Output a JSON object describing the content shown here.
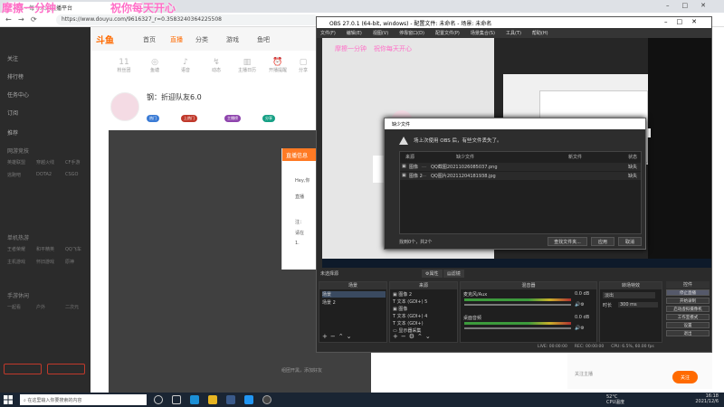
{
  "overlay": {
    "left": "摩擦一分钟",
    "right": "祝你每天开心"
  },
  "browser": {
    "tab_title": "斗鱼 - 每个人的直播平台",
    "url": "https://www.douyu.com/9616327_r=0.3583240364225508",
    "nav_items": [
      "首页",
      "直播",
      "分类",
      "游戏",
      "鱼吧"
    ],
    "logo": "斗鱼",
    "icon_row": [
      {
        "glyph": "11",
        "label": "粉丝团"
      },
      {
        "glyph": "◎",
        "label": "鱼塘"
      },
      {
        "glyph": "♪",
        "label": "语音"
      },
      {
        "glyph": "↯",
        "label": "动态"
      },
      {
        "glyph": "▥",
        "label": "主播日历"
      },
      {
        "glyph": "⏰",
        "label": "开播提醒"
      },
      {
        "glyph": "▢",
        "label": "分享"
      }
    ],
    "streamer_name": "钢：折迎队友6.0",
    "badges": [
      "热门",
      "上热门",
      "主播榜",
      "分享"
    ],
    "sidebar_items": [
      "关注",
      "排行榜",
      "任务中心",
      "订阅",
      "推荐"
    ],
    "sidebar_heads": [
      "网游竞技",
      "单机热游",
      "手游休闲"
    ],
    "sidebar_grid": [
      [
        "英雄联盟",
        "穿越火线",
        "CF手游"
      ],
      [
        "逃跑吧",
        "DOTA2",
        "CSGO"
      ],
      [
        "王者荣耀",
        "和平精英",
        "QQ飞车"
      ],
      [
        "主机游戏",
        "怀旧游戏",
        "原神"
      ],
      [
        "一起看",
        "户外",
        "二次元"
      ]
    ],
    "dialog_title": "直播信息",
    "dialog_lines": [
      "Hey,你",
      "直播",
      "注：",
      "请在",
      "1."
    ],
    "notice": "组团开黑，添加好友",
    "right_text": "关注主播",
    "subscribe": "关注"
  },
  "obs": {
    "title": "OBS 27.0.1 (64-bit, windows) - 配置文件: 未命名 - 场景: 未命名",
    "menu": [
      "文件(F)",
      "编辑(E)",
      "视图(V)",
      "停靠窗口(D)",
      "配置文件(P)",
      "场景集合(S)",
      "工具(T)",
      "帮助(H)"
    ],
    "missing_dialog": {
      "title": "缺少文件",
      "warning": "场上次使用 OBS 后，有些文件丢失了。",
      "columns": [
        "来源",
        "缺少文件",
        "新文件",
        "状态"
      ],
      "rows": [
        {
          "source": "图像",
          "missing": "QQ截图20211026085037.png",
          "new": "",
          "status": "缺失"
        },
        {
          "source": "图像 2",
          "missing": "QQ图片20211204181938.jpg",
          "new": "",
          "status": "缺失"
        }
      ],
      "footer": "找到0个，共2个",
      "buttons": [
        "查找文件夹...",
        "应用",
        "取消"
      ]
    },
    "scene_bar": {
      "label": "未选择源",
      "props": "属性",
      "filters": "滤镜"
    },
    "docks": {
      "scenes": {
        "title": "场景",
        "items": [
          "场景",
          "场景 2"
        ]
      },
      "sources": {
        "title": "来源",
        "items": [
          "图像 2",
          "文本 (GDI+) 5",
          "图像",
          "文本 (GDI+) 4",
          "文本 (GDI+)",
          "显示器采集"
        ]
      },
      "mixer": {
        "title": "混音器",
        "channels": [
          {
            "name": "麦克风/Aux",
            "db": "0.0 dB"
          },
          {
            "name": "桌面音频",
            "db": "0.0 dB"
          }
        ]
      },
      "transitions": {
        "title": "转场特效",
        "type": "淡出",
        "duration_label": "时长",
        "duration": "300 ms"
      },
      "controls": {
        "title": "控件",
        "buttons": [
          "停止直播",
          "开始录制",
          "启动虚拟摄像机",
          "工作室模式",
          "设置",
          "退出"
        ]
      }
    },
    "status": [
      "LIVE: 00:00:00",
      "REC: 00:00:00",
      "CPU: 6.5%, 60.00 fps"
    ]
  },
  "taskbar": {
    "search_placeholder": "在这里输入你要搜索的内容",
    "weather_temp": "52°C",
    "weather_label": "CPU温度",
    "time": "16:18",
    "date": "2021/12/6"
  },
  "colors": {
    "accent": "#ff6a00",
    "overlay": "#ff6ec7",
    "obs_bg": "#2b2b2b"
  }
}
